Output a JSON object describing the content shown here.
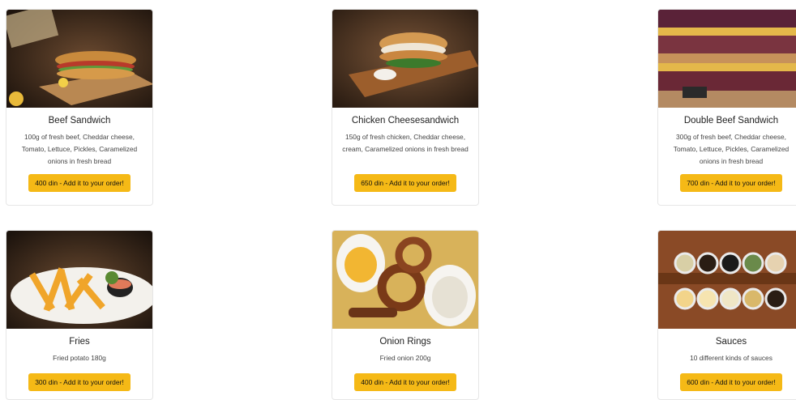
{
  "products": [
    {
      "name": "Beef Sandwich",
      "description": "100g of fresh beef, Cheddar cheese, Tomato, Lettuce, Pickles, Caramelized onions in fresh bread",
      "button": "400 din - Add it to your order!",
      "image": "beef-sandwich-photo"
    },
    {
      "name": "Chicken Cheesesandwich",
      "description": "150g of fresh chicken, Cheddar cheese, cream, Caramelized onions in fresh bread",
      "button": "650 din - Add it to your order!",
      "image": "chicken-sandwich-photo"
    },
    {
      "name": "Double Beef Sandwich",
      "description": "300g of fresh beef, Cheddar cheese, Tomato, Lettuce, Pickles, Caramelized onions in fresh bread",
      "button": "700 din - Add it to your order!",
      "image": "double-beef-sandwich-photo"
    },
    {
      "name": "Fries",
      "description": "Fried potato 180g",
      "button": "300 din - Add it to your order!",
      "image": "fries-photo"
    },
    {
      "name": "Onion Rings",
      "description": "Fried onion 200g",
      "button": "400 din - Add it to your order!",
      "image": "onion-rings-photo"
    },
    {
      "name": "Sauces",
      "description": "10 different kinds of sauces",
      "button": "600 din - Add it to your order!",
      "image": "sauces-photo"
    }
  ],
  "colors": {
    "button": "#f5b916",
    "card_border": "#e6e6e6"
  }
}
